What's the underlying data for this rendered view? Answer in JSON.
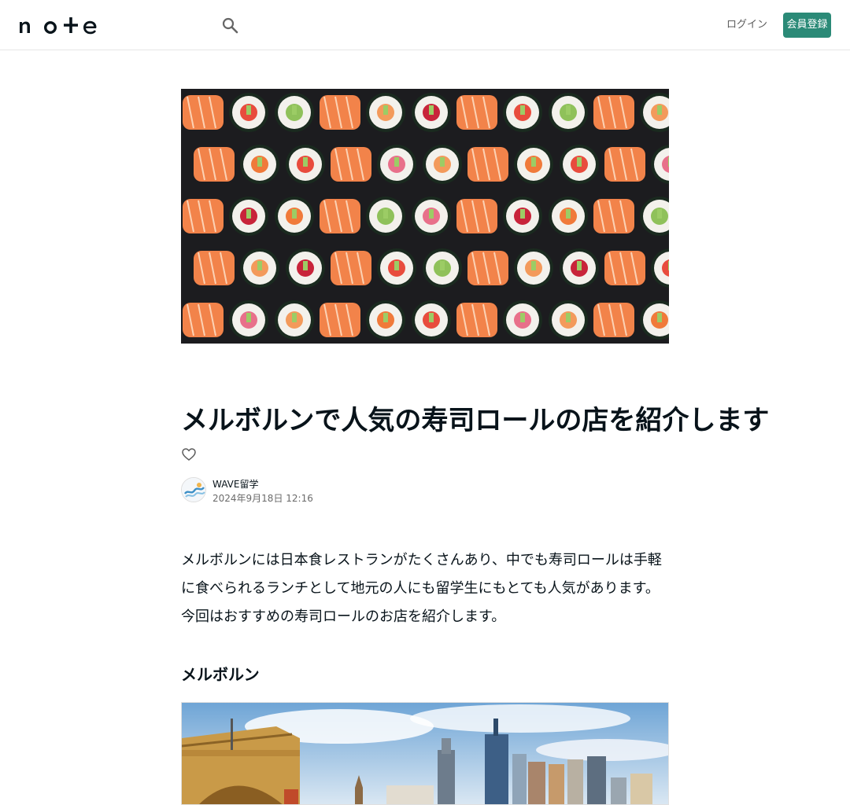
{
  "header": {
    "logo_text": "note",
    "search_icon": "search-icon",
    "login_label": "ログイン",
    "signup_label": "会員登録",
    "accent_color": "#2b8a77"
  },
  "hero": {
    "image": "sushi-rolls-photo"
  },
  "article": {
    "title": "メルボルンで人気の寿司ロールの店を紹介します",
    "like_icon": "heart-outline-icon",
    "author": {
      "name": "WAVE留学",
      "date": "2024年9月18日 12:16"
    },
    "paragraph_1": "メルボルンには日本食レストランがたくさんあり、中でも寿司ロールは手軽に食べられるランチとして地元の人にも留学生にもとても人気があります。",
    "paragraph_2": "今回はおすすめの寿司ロールのお店を紹介します。",
    "section_heading": "メルボルン"
  },
  "section_image": {
    "image": "melbourne-city-skyline-photo"
  }
}
